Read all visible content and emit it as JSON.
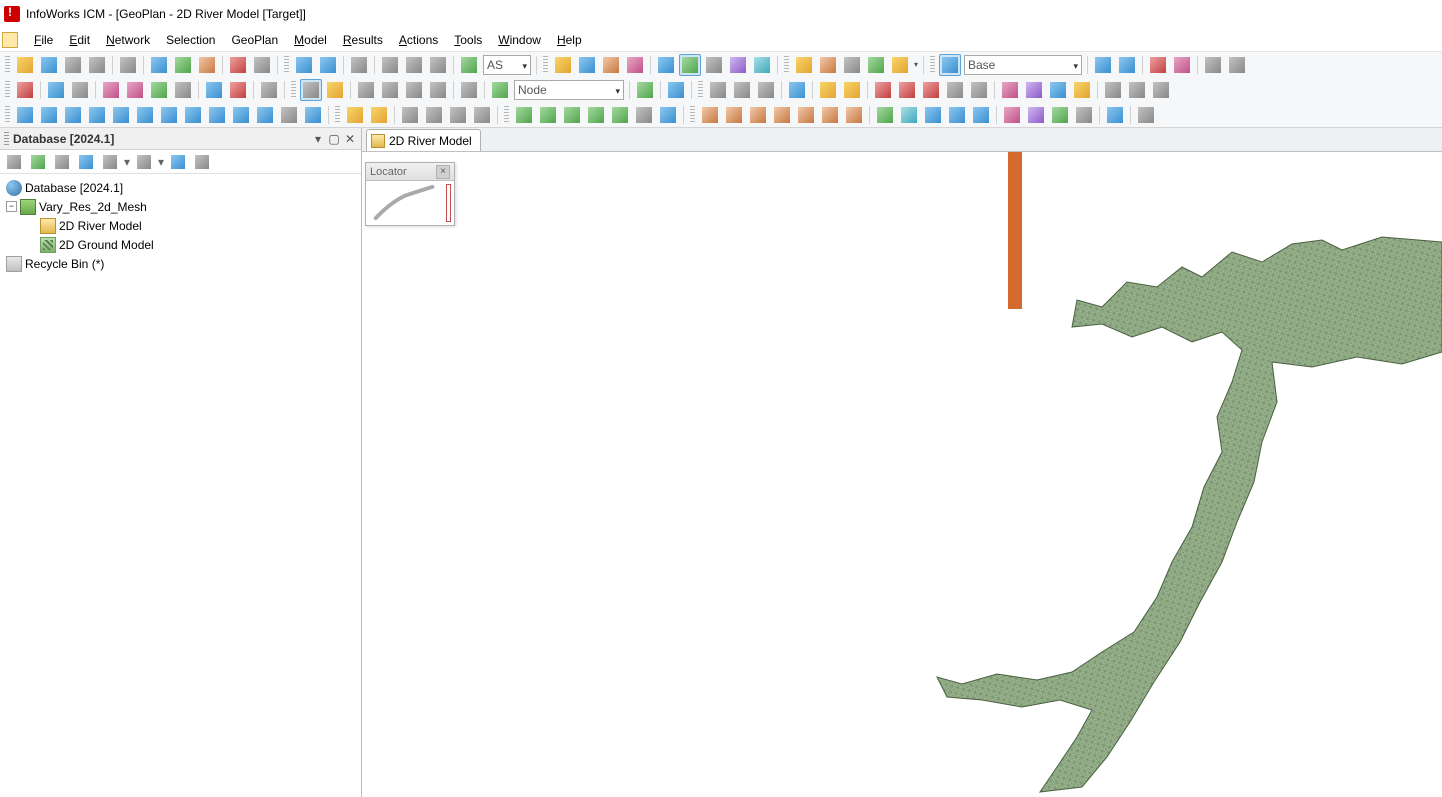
{
  "app": {
    "name": "InfoWorks ICM",
    "document_title": "[GeoPlan - 2D River Model [Target]]",
    "full_title": "InfoWorks ICM           - [GeoPlan - 2D River Model [Target]]"
  },
  "menu": {
    "file": "File",
    "edit": "Edit",
    "network": "Network",
    "selection": "Selection",
    "geoplan": "GeoPlan",
    "model": "Model",
    "results": "Results",
    "actions": "Actions",
    "tools": "Tools",
    "window": "Window",
    "help": "Help"
  },
  "toolbar": {
    "combo_as": "AS",
    "combo_node": "Node",
    "combo_base": "Base"
  },
  "db_panel": {
    "title": "Database [2024.1]",
    "root": "Database [2024.1]",
    "group": "Vary_Res_2d_Mesh",
    "river": "2D River Model",
    "ground": "2D Ground Model",
    "bin": "Recycle Bin (*)"
  },
  "tab": {
    "label": "2D River Model"
  },
  "locator": {
    "title": "Locator"
  }
}
